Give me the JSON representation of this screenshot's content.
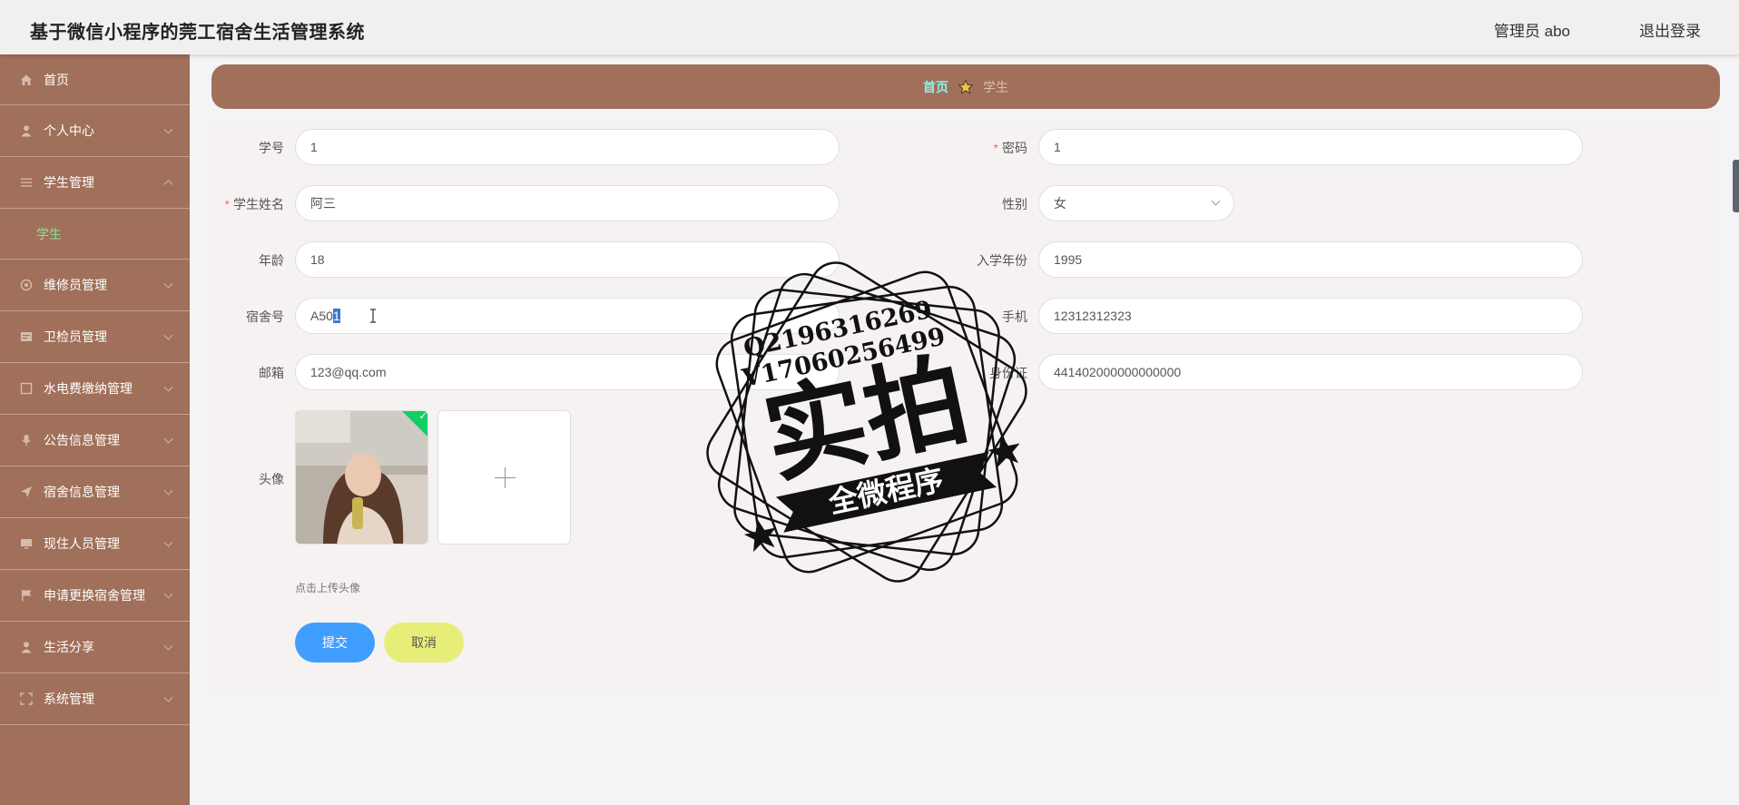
{
  "header": {
    "title": "基于微信小程序的莞工宿舍生活管理系统",
    "admin": "管理员 abo",
    "logout": "退出登录"
  },
  "sidebar": {
    "items": [
      {
        "label": "首页",
        "icon": "home-icon"
      },
      {
        "label": "个人中心",
        "icon": "user-icon"
      },
      {
        "label": "学生管理",
        "icon": "menu-icon",
        "expanded": true,
        "children": [
          "学生"
        ]
      },
      {
        "label": "维修员管理",
        "icon": "circle-icon"
      },
      {
        "label": "卫检员管理",
        "icon": "card-icon"
      },
      {
        "label": "水电费缴纳管理",
        "icon": "square-icon"
      },
      {
        "label": "公告信息管理",
        "icon": "mic-icon"
      },
      {
        "label": "宿舍信息管理",
        "icon": "send-icon"
      },
      {
        "label": "现住人员管理",
        "icon": "monitor-icon"
      },
      {
        "label": "申请更换宿舍管理",
        "icon": "flag-icon"
      },
      {
        "label": "生活分享",
        "icon": "user-icon"
      },
      {
        "label": "系统管理",
        "icon": "fullscreen-icon"
      }
    ]
  },
  "breadcrumb": {
    "home": "首页",
    "current": "学生"
  },
  "form": {
    "student_no": {
      "label": "学号",
      "value": "1"
    },
    "password": {
      "label": "密码",
      "value": "1"
    },
    "student_name": {
      "label": "学生姓名",
      "value": "阿三"
    },
    "gender": {
      "label": "性别",
      "value": "女"
    },
    "age": {
      "label": "年龄",
      "value": "18"
    },
    "enroll_year": {
      "label": "入学年份",
      "value": "1995"
    },
    "dorm_no": {
      "label": "宿舍号",
      "value_prefix": "A50",
      "value_selected": "1"
    },
    "phone": {
      "label": "手机",
      "value": "12312312323"
    },
    "email": {
      "label": "邮箱",
      "value": "123@qq.com"
    },
    "id_card": {
      "label": "身份证",
      "value": "441402000000000000"
    },
    "avatar": {
      "label": "头像",
      "hint": "点击上传头像"
    },
    "submit": "提交",
    "cancel": "取消"
  },
  "watermark": {
    "line1": "Q2196316269",
    "line2": "V17060256499",
    "main": "实拍",
    "banner": "全微程序"
  }
}
